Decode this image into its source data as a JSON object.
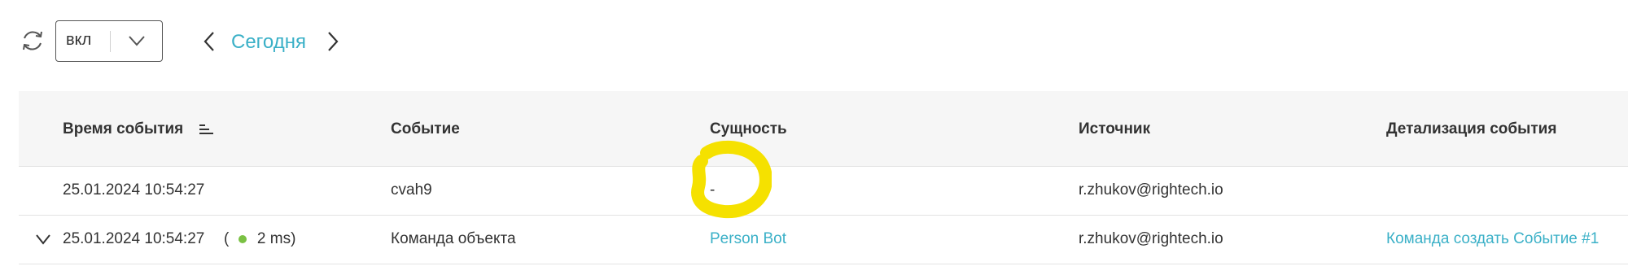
{
  "toolbar": {
    "refresh_icon": "refresh-icon",
    "live_select": {
      "value": "вкл",
      "icon": "chevron-down-icon"
    },
    "prev_icon": "chevron-left-icon",
    "date_label": "Сегодня",
    "next_icon": "chevron-right-icon"
  },
  "table": {
    "columns": [
      {
        "label": "Время события",
        "sort_icon": "sort-icon"
      },
      {
        "label": "Событие"
      },
      {
        "label": "Сущность"
      },
      {
        "label": "Источник"
      },
      {
        "label": "Детализация события"
      }
    ],
    "rows": [
      {
        "time": "25.01.2024 10:54:27",
        "event": "cvah9",
        "entity": "-",
        "source": "r.zhukov@rightech.io",
        "detail": ""
      },
      {
        "expand_icon": "chevron-down-icon",
        "time": "25.01.2024 10:54:27",
        "duration_open": "(",
        "duration": "2 ms)",
        "event": "Команда объекта",
        "entity": "Person Bot",
        "source": "r.zhukov@rightech.io",
        "detail": "Команда создать Событие #1"
      }
    ]
  },
  "colors": {
    "accent": "#3ab0c7",
    "status_ok": "#7ac143",
    "highlight": "#f5e100",
    "header_bg": "#f6f6f6"
  }
}
